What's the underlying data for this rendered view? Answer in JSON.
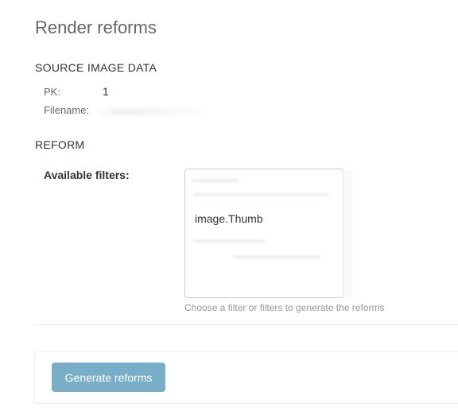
{
  "page": {
    "title": "Render reforms"
  },
  "source_image_data": {
    "heading": "SOURCE IMAGE DATA",
    "pk_label": "PK:",
    "pk_value": "1",
    "filename_label": "Filename:"
  },
  "reform": {
    "heading": "REFORM",
    "filters_label": "Available filters:",
    "filter_options": [
      "image.Thumb"
    ],
    "help_text": "Choose a filter or filters to generate the reforms"
  },
  "actions": {
    "generate_label": "Generate reforms",
    "button_color": "#79aec8"
  }
}
